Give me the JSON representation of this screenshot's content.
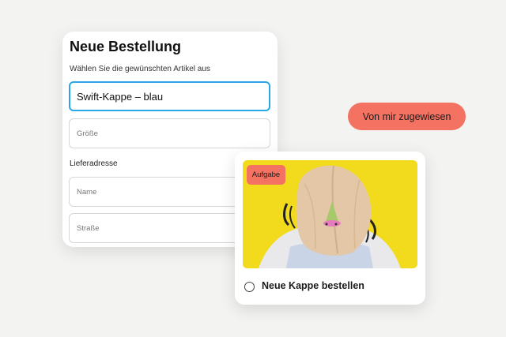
{
  "order_form": {
    "title": "Neue Bestellung",
    "subtitle": "Wählen Sie die gewünschten Artikel aus",
    "product_value": "Swift-Kappe – blau",
    "size_placeholder": "Größe",
    "address_label": "Lieferadresse",
    "name_placeholder": "Name",
    "street_placeholder": "Straße"
  },
  "assignment": {
    "label": "Von mir zugewiesen"
  },
  "task_card": {
    "badge": "Aufgabe",
    "title": "Neue Kappe bestellen",
    "image_description_icon": "cap-photo"
  },
  "colors": {
    "accent": "#f37262",
    "focus": "#29a7e6",
    "background": "#f3f3f1",
    "photo_background": "#f2da1c"
  }
}
